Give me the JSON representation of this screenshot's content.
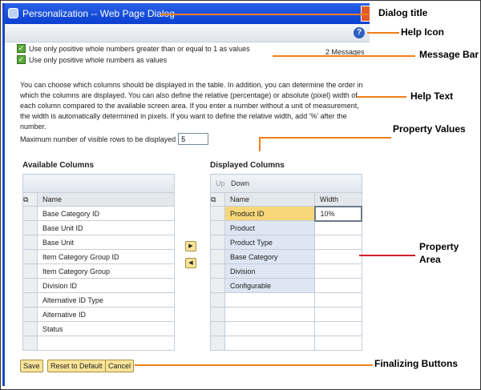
{
  "dialog": {
    "title": "Personalization -- Web Page Dialog"
  },
  "messages": [
    "Use only positive whole numbers greater than or equal to 1 as values",
    "Use only positive whole numbers as values"
  ],
  "message_count": "2 Messages",
  "help_text": "You can choose which columns should be displayed in the table. In addition, you can determine the order in which the columns are displayed. You can also define the relative (percentage) or absolute (pixel) width of each column compared to the available screen area. If you enter a number without a unit of measurement, the width is automatically determined in pixels. If you want to define the relative width, add '%' after the number.",
  "max_rows": {
    "label": "Maximum number of visible rows to be displayed",
    "value": "5"
  },
  "available": {
    "title": "Available Columns",
    "header": "Name",
    "rows": [
      "Base Category ID",
      "Base Unit ID",
      "Base Unit",
      "Item Category Group ID",
      "Item Category Group",
      "Division ID",
      "Alternative ID Type",
      "Alternative ID",
      "Status",
      ""
    ]
  },
  "displayed": {
    "title": "Displayed Columns",
    "up": "Up",
    "down": "Down",
    "header_name": "Name",
    "header_width": "Width",
    "rows": [
      {
        "name": "Product ID",
        "width": "10%"
      },
      {
        "name": "Product",
        "width": ""
      },
      {
        "name": "Product Type",
        "width": ""
      },
      {
        "name": "Base Category",
        "width": ""
      },
      {
        "name": "Division",
        "width": ""
      },
      {
        "name": "Configurable",
        "width": ""
      },
      {
        "name": "",
        "width": ""
      },
      {
        "name": "",
        "width": ""
      },
      {
        "name": "",
        "width": ""
      },
      {
        "name": "",
        "width": ""
      }
    ]
  },
  "buttons": {
    "save": "Save",
    "reset": "Reset to Default",
    "cancel": "Cancel"
  },
  "annotations": {
    "dialog_title": "Dialog title",
    "help_icon": "Help Icon",
    "message_bar": "Message Bar",
    "help_text": "Help Text",
    "property_values": "Property Values",
    "property_area_1": "Property",
    "property_area_2": "Area",
    "finalizing": "Finalizing Buttons"
  },
  "colors": {
    "annotation_line": "#f07d1a",
    "property_area_line": "#d0202a",
    "title_bar": "#0a3fd0",
    "button": "#f9e49a"
  }
}
